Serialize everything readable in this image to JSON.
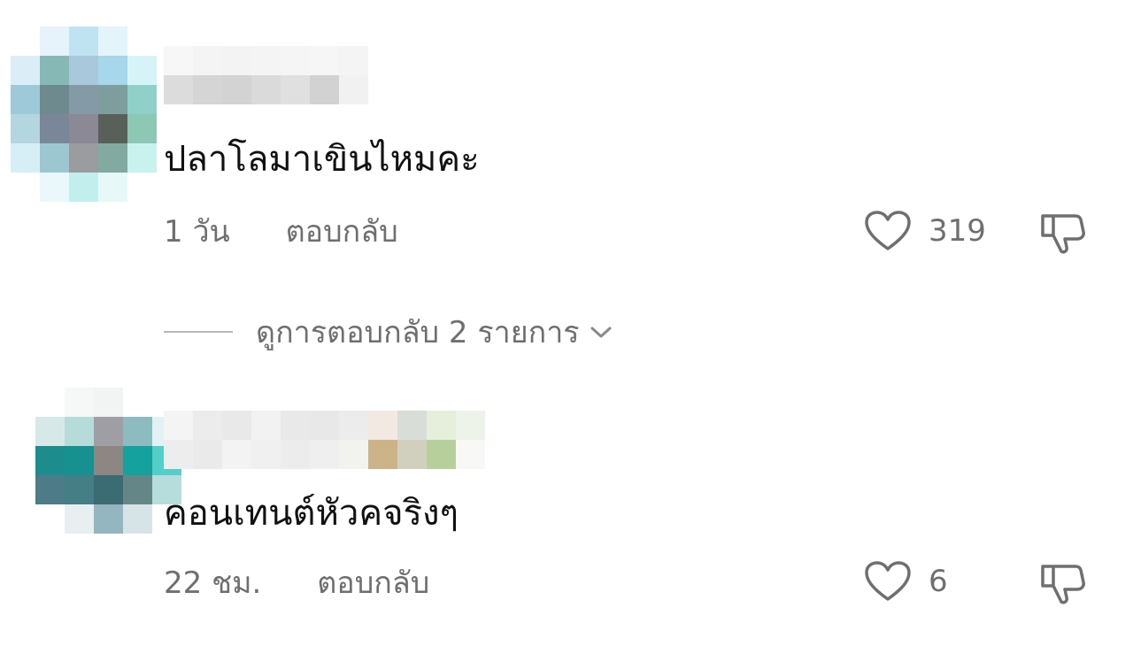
{
  "comments": [
    {
      "text": "ปลาโลมาเขินไหมคะ",
      "time": "1 วัน",
      "reply_label": "ตอบกลับ",
      "likes": "319",
      "avatar_colors": [
        "#ffffff",
        "#e6f3fb",
        "#bfe3f0",
        "#e3f4fb",
        "#ffffff",
        "#dbeef8",
        "#86b9b6",
        "#a9c8dc",
        "#a6d7ea",
        "#d6f4f7",
        "#9ec9d8",
        "#6f8a8f",
        "#849aa6",
        "#7d9e9c",
        "#8fd0c8",
        "#b4d6e0",
        "#7a8799",
        "#8b8995",
        "#59605a",
        "#8cc8b4",
        "#d6eef6",
        "#9cc7d1",
        "#9a9c9f",
        "#82aaa0",
        "#c9f2ee",
        "#ffffff",
        "#eaf8fb",
        "#c2efee",
        "#e7f8f9",
        "#ffffff"
      ],
      "name_colors": [
        "#f7f7f7",
        "#f4f4f4",
        "#f3f3f3",
        "#f4f4f4",
        "#f5f5f5",
        "#f6f6f6",
        "#f4f4f4",
        "#dcdcdc",
        "#d5d5d5",
        "#d3d3d3",
        "#dadada",
        "#e0e0e0",
        "#d2d2d2",
        "#f1f1f1"
      ]
    },
    {
      "text": "คอนเทนต์หัวคจริงๆ",
      "time": "22 ชม.",
      "reply_label": "ตอบกลับ",
      "likes": "6",
      "avatar_colors": [
        "#ffffff",
        "#f6f8f8",
        "#f2f4f4",
        "#ffffff",
        "#ffffff",
        "#d6e9e8",
        "#b6dcda",
        "#a09ea5",
        "#8cbcc0",
        "#e2f2f4",
        "#1c8c8c",
        "#16918f",
        "#8e8683",
        "#15a19d",
        "#51cfc8",
        "#4d7b87",
        "#467e86",
        "#3b6b73",
        "#658686",
        "#b7dcdc",
        "#ffffff",
        "#e9eef0",
        "#93b6c0",
        "#d6e4e8",
        "#ffffff"
      ],
      "name_colors": [
        "#f4f4f4",
        "#ececec",
        "#e9e9e9",
        "#f2f2f2",
        "#e9e9e9",
        "#e8e8e8",
        "#ececec",
        "#f2e9e3",
        "#d9ddd8",
        "#e6efdc",
        "#eef3ea",
        "#ededed",
        "#eaeaea",
        "#f3f3f3",
        "#f0f0f0",
        "#ececec",
        "#efefef",
        "#f2f2ef",
        "#cdb388",
        "#d1d0bf",
        "#b7d09b",
        "#f8f9f7"
      ]
    }
  ],
  "view_replies": "ดูการตอบกลับ 2 รายการ",
  "colors": {
    "secondary_text": "#6f6f6f",
    "divider": "#b8b8b8"
  }
}
